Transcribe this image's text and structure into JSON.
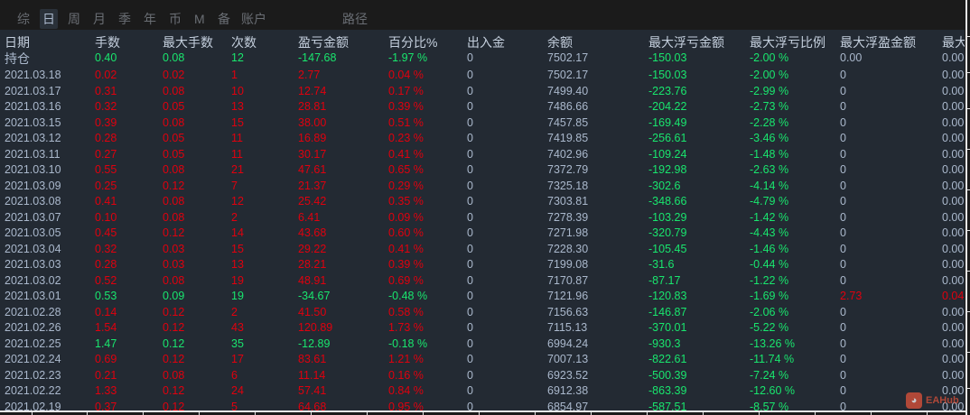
{
  "tabs": [
    "综",
    "日",
    "周",
    "月",
    "季",
    "年",
    "币",
    "M",
    "备",
    "账户",
    "路径"
  ],
  "active_tab": 1,
  "headers": [
    "日期",
    "手数",
    "最大手数",
    "次数",
    "盈亏金额",
    "百分比%",
    "出入金",
    "余额",
    "最大浮亏金额",
    "最大浮亏比例",
    "最大浮盈金额",
    "最大"
  ],
  "holding": {
    "label": "持仓",
    "lots": "0.40",
    "max_lots": "0.08",
    "count": "12",
    "pnl": "-147.68",
    "pct": "-1.97 %",
    "flow": "0",
    "balance": "7502.17",
    "max_float_loss": "-150.03",
    "max_float_loss_pct": "-2.00 %",
    "max_float_profit": "0.00",
    "last": "0.00"
  },
  "rows": [
    [
      "2021.03.18",
      "0.02",
      "0.02",
      "1",
      "2.77",
      "0.04 %",
      "0",
      "7502.17",
      "-150.03",
      "-2.00 %",
      "0",
      "0.00"
    ],
    [
      "2021.03.17",
      "0.31",
      "0.08",
      "10",
      "12.74",
      "0.17 %",
      "0",
      "7499.40",
      "-223.76",
      "-2.99 %",
      "0",
      "0.00"
    ],
    [
      "2021.03.16",
      "0.32",
      "0.05",
      "13",
      "28.81",
      "0.39 %",
      "0",
      "7486.66",
      "-204.22",
      "-2.73 %",
      "0",
      "0.00"
    ],
    [
      "2021.03.15",
      "0.39",
      "0.08",
      "15",
      "38.00",
      "0.51 %",
      "0",
      "7457.85",
      "-169.49",
      "-2.28 %",
      "0",
      "0.00"
    ],
    [
      "2021.03.12",
      "0.28",
      "0.05",
      "11",
      "16.89",
      "0.23 %",
      "0",
      "7419.85",
      "-256.61",
      "-3.46 %",
      "0",
      "0.00"
    ],
    [
      "2021.03.11",
      "0.27",
      "0.05",
      "11",
      "30.17",
      "0.41 %",
      "0",
      "7402.96",
      "-109.24",
      "-1.48 %",
      "0",
      "0.00"
    ],
    [
      "2021.03.10",
      "0.55",
      "0.08",
      "21",
      "47.61",
      "0.65 %",
      "0",
      "7372.79",
      "-192.98",
      "-2.63 %",
      "0",
      "0.00"
    ],
    [
      "2021.03.09",
      "0.25",
      "0.12",
      "7",
      "21.37",
      "0.29 %",
      "0",
      "7325.18",
      "-302.6",
      "-4.14 %",
      "0",
      "0.00"
    ],
    [
      "2021.03.08",
      "0.41",
      "0.08",
      "12",
      "25.42",
      "0.35 %",
      "0",
      "7303.81",
      "-348.66",
      "-4.79 %",
      "0",
      "0.00"
    ],
    [
      "2021.03.07",
      "0.10",
      "0.08",
      "2",
      "6.41",
      "0.09 %",
      "0",
      "7278.39",
      "-103.29",
      "-1.42 %",
      "0",
      "0.00"
    ],
    [
      "2021.03.05",
      "0.45",
      "0.12",
      "14",
      "43.68",
      "0.60 %",
      "0",
      "7271.98",
      "-320.79",
      "-4.43 %",
      "0",
      "0.00"
    ],
    [
      "2021.03.04",
      "0.32",
      "0.03",
      "15",
      "29.22",
      "0.41 %",
      "0",
      "7228.30",
      "-105.45",
      "-1.46 %",
      "0",
      "0.00"
    ],
    [
      "2021.03.03",
      "0.28",
      "0.03",
      "13",
      "28.21",
      "0.39 %",
      "0",
      "7199.08",
      "-31.6",
      "-0.44 %",
      "0",
      "0.00"
    ],
    [
      "2021.03.02",
      "0.52",
      "0.08",
      "19",
      "48.91",
      "0.69 %",
      "0",
      "7170.87",
      "-87.17",
      "-1.22 %",
      "0",
      "0.00"
    ],
    [
      "2021.03.01",
      "0.53",
      "0.09",
      "19",
      "-34.67",
      "-0.48 %",
      "0",
      "7121.96",
      "-120.83",
      "-1.69 %",
      "2.73",
      "0.04"
    ],
    [
      "2021.02.28",
      "0.14",
      "0.12",
      "2",
      "41.50",
      "0.58 %",
      "0",
      "7156.63",
      "-146.87",
      "-2.06 %",
      "0",
      "0.00"
    ],
    [
      "2021.02.26",
      "1.54",
      "0.12",
      "43",
      "120.89",
      "1.73 %",
      "0",
      "7115.13",
      "-370.01",
      "-5.22 %",
      "0",
      "0.00"
    ],
    [
      "2021.02.25",
      "1.47",
      "0.12",
      "35",
      "-12.89",
      "-0.18 %",
      "0",
      "6994.24",
      "-930.3",
      "-13.26 %",
      "0",
      "0.00"
    ],
    [
      "2021.02.24",
      "0.69",
      "0.12",
      "17",
      "83.61",
      "1.21 %",
      "0",
      "7007.13",
      "-822.61",
      "-11.74 %",
      "0",
      "0.00"
    ],
    [
      "2021.02.23",
      "0.21",
      "0.08",
      "6",
      "11.14",
      "0.16 %",
      "0",
      "6923.52",
      "-500.39",
      "-7.24 %",
      "0",
      "0.00"
    ],
    [
      "2021.02.22",
      "1.33",
      "0.12",
      "24",
      "57.41",
      "0.84 %",
      "0",
      "6912.38",
      "-863.39",
      "-12.60 %",
      "0",
      "0.00"
    ],
    [
      "2021.02.19",
      "0.37",
      "0.12",
      "5",
      "64.68",
      "0.95 %",
      "0",
      "6854.97",
      "-587.51",
      "-8.57 %",
      "0",
      "0.00"
    ]
  ],
  "colors": {
    "profit": "#e0000e",
    "loss": "#19e66e",
    "neutral": "#aab8cc",
    "background": "#232a33"
  },
  "watermark": "EAHub"
}
